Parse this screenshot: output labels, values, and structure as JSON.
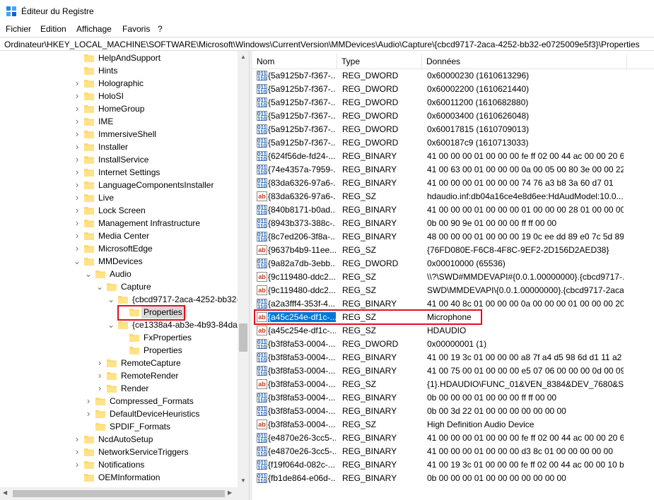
{
  "window": {
    "title": "Éditeur du Registre",
    "icon": "registry-editor-icon"
  },
  "menu": [
    "Fichier",
    "Edition",
    "Affichage",
    "Favoris",
    "?"
  ],
  "address": "Ordinateur\\HKEY_LOCAL_MACHINE\\SOFTWARE\\Microsoft\\Windows\\CurrentVersion\\MMDevices\\Audio\\Capture\\{cbcd9717-2aca-4252-bb32-e0725009e5f3}\\Properties",
  "tree": {
    "selected_label": "Properties",
    "items": [
      {
        "label": "HelpAndSupport",
        "depth": 0,
        "expander": ""
      },
      {
        "label": "Hints",
        "depth": 0,
        "expander": ""
      },
      {
        "label": "Holographic",
        "depth": 0,
        "expander": "collapsed"
      },
      {
        "label": "HoloSI",
        "depth": 0,
        "expander": "collapsed"
      },
      {
        "label": "HomeGroup",
        "depth": 0,
        "expander": "collapsed"
      },
      {
        "label": "IME",
        "depth": 0,
        "expander": "collapsed"
      },
      {
        "label": "ImmersiveShell",
        "depth": 0,
        "expander": "collapsed"
      },
      {
        "label": "Installer",
        "depth": 0,
        "expander": "collapsed"
      },
      {
        "label": "InstallService",
        "depth": 0,
        "expander": "collapsed"
      },
      {
        "label": "Internet Settings",
        "depth": 0,
        "expander": "collapsed"
      },
      {
        "label": "LanguageComponentsInstaller",
        "depth": 0,
        "expander": "collapsed"
      },
      {
        "label": "Live",
        "depth": 0,
        "expander": "collapsed"
      },
      {
        "label": "Lock Screen",
        "depth": 0,
        "expander": "collapsed"
      },
      {
        "label": "Management Infrastructure",
        "depth": 0,
        "expander": "collapsed"
      },
      {
        "label": "Media Center",
        "depth": 0,
        "expander": "collapsed"
      },
      {
        "label": "MicrosoftEdge",
        "depth": 0,
        "expander": "collapsed"
      },
      {
        "label": "MMDevices",
        "depth": 0,
        "expander": "expanded"
      },
      {
        "label": "Audio",
        "depth": 1,
        "expander": "expanded"
      },
      {
        "label": "Capture",
        "depth": 2,
        "expander": "expanded"
      },
      {
        "label": "{cbcd9717-2aca-4252-bb32-",
        "depth": 3,
        "expander": "expanded"
      },
      {
        "label": "Properties",
        "depth": 4,
        "expander": "",
        "selected": true
      },
      {
        "label": "{ce1338a4-ab3e-4b93-84da-",
        "depth": 3,
        "expander": "expanded"
      },
      {
        "label": "FxProperties",
        "depth": 4,
        "expander": ""
      },
      {
        "label": "Properties",
        "depth": 4,
        "expander": ""
      },
      {
        "label": "RemoteCapture",
        "depth": 2,
        "expander": "collapsed"
      },
      {
        "label": "RemoteRender",
        "depth": 2,
        "expander": "collapsed"
      },
      {
        "label": "Render",
        "depth": 2,
        "expander": "collapsed"
      },
      {
        "label": "Compressed_Formats",
        "depth": 1,
        "expander": "collapsed"
      },
      {
        "label": "DefaultDeviceHeuristics",
        "depth": 1,
        "expander": "collapsed"
      },
      {
        "label": "SPDIF_Formats",
        "depth": 1,
        "expander": ""
      },
      {
        "label": "NcdAutoSetup",
        "depth": 0,
        "expander": "collapsed"
      },
      {
        "label": "NetworkServiceTriggers",
        "depth": 0,
        "expander": "collapsed"
      },
      {
        "label": "Notifications",
        "depth": 0,
        "expander": "collapsed"
      },
      {
        "label": "OEMInformation",
        "depth": 0,
        "expander": ""
      }
    ]
  },
  "list": {
    "columns": [
      "Nom",
      "Type",
      "Données"
    ],
    "rows": [
      {
        "name": "{5a9125b7-f367-...",
        "type": "REG_DWORD",
        "data": "0x60000230 (1610613296)",
        "icon": "binary-value-icon"
      },
      {
        "name": "{5a9125b7-f367-...",
        "type": "REG_DWORD",
        "data": "0x60002200 (1610621440)",
        "icon": "binary-value-icon"
      },
      {
        "name": "{5a9125b7-f367-...",
        "type": "REG_DWORD",
        "data": "0x60011200 (1610682880)",
        "icon": "binary-value-icon"
      },
      {
        "name": "{5a9125b7-f367-...",
        "type": "REG_DWORD",
        "data": "0x60003400 (1610626048)",
        "icon": "binary-value-icon"
      },
      {
        "name": "{5a9125b7-f367-...",
        "type": "REG_DWORD",
        "data": "0x60017815 (1610709013)",
        "icon": "binary-value-icon"
      },
      {
        "name": "{5a9125b7-f367-...",
        "type": "REG_DWORD",
        "data": "0x600187c9 (1610713033)",
        "icon": "binary-value-icon"
      },
      {
        "name": "{624f56de-fd24-...",
        "type": "REG_BINARY",
        "data": "41 00 00 00 01 00 00 00 fe ff 02 00 44 ac 00 00 20 62 ...",
        "icon": "binary-value-icon"
      },
      {
        "name": "{74e4357a-7959-...",
        "type": "REG_BINARY",
        "data": "41 00 63 00 01 00 00 00 0a 00 05 00 80 3e 00 00 22 56...",
        "icon": "binary-value-icon"
      },
      {
        "name": "{83da6326-97a6-...",
        "type": "REG_BINARY",
        "data": "41 00 00 00 01 00 00 00 74 76 a3 b8 3a 60 d7 01",
        "icon": "binary-value-icon"
      },
      {
        "name": "{83da6326-97a6-...",
        "type": "REG_SZ",
        "data": "hdaudio.inf:db04a16ce4e8d6ee:HdAudModel:10.0....",
        "icon": "string-value-icon"
      },
      {
        "name": "{840b8171-b0ad...",
        "type": "REG_BINARY",
        "data": "41 00 00 00 01 00 00 00 01 00 00 00 28 01 00 00 00 00...",
        "icon": "binary-value-icon"
      },
      {
        "name": "{8943b373-388c-...",
        "type": "REG_BINARY",
        "data": "0b 00 90 9e 01 00 00 00 ff ff 00 00",
        "icon": "binary-value-icon"
      },
      {
        "name": "{8c7ed206-3f8a-...",
        "type": "REG_BINARY",
        "data": "48 00 00 00 01 00 00 00 19 0c ee dd 89 e0 7c 5d 89 5...",
        "icon": "binary-value-icon"
      },
      {
        "name": "{9637b4b9-11ee...",
        "type": "REG_SZ",
        "data": "{76FD080E-F6C8-4F8C-9EF2-2D156D2AED38}",
        "icon": "string-value-icon"
      },
      {
        "name": "{9a82a7db-3ebb...",
        "type": "REG_DWORD",
        "data": "0x00010000 (65536)",
        "icon": "binary-value-icon"
      },
      {
        "name": "{9c119480-ddc2...",
        "type": "REG_SZ",
        "data": "\\\\?\\SWD#MMDEVAPI#{0.0.1.00000000}.{cbcd9717-...",
        "icon": "string-value-icon"
      },
      {
        "name": "{9c119480-ddc2...",
        "type": "REG_SZ",
        "data": "SWD\\MMDEVAPI\\{0.0.1.00000000}.{cbcd9717-2aca...",
        "icon": "string-value-icon"
      },
      {
        "name": "{a2a3fff4-353f-4...",
        "type": "REG_BINARY",
        "data": "41 00 40 8c 01 00 00 00 0a 00 00 00 01 00 00 00 20 ea...",
        "icon": "binary-value-icon"
      },
      {
        "name": "{a45c254e-df1c-...",
        "type": "REG_SZ",
        "data": "Microphone",
        "icon": "string-value-icon",
        "selected": true
      },
      {
        "name": "{a45c254e-df1c-...",
        "type": "REG_SZ",
        "data": "HDAUDIO",
        "icon": "string-value-icon"
      },
      {
        "name": "{b3f8fa53-0004-...",
        "type": "REG_DWORD",
        "data": "0x00000001 (1)",
        "icon": "binary-value-icon"
      },
      {
        "name": "{b3f8fa53-0004-...",
        "type": "REG_BINARY",
        "data": "41 00 19 3c 01 00 00 00 a8 7f a4 d5 98 6d d1 11 a2 1...",
        "icon": "binary-value-icon"
      },
      {
        "name": "{b3f8fa53-0004-...",
        "type": "REG_BINARY",
        "data": "41 00 75 00 01 00 00 00 e5 07 06 00 00 00 0d 00 09 0...",
        "icon": "binary-value-icon"
      },
      {
        "name": "{b3f8fa53-0004-...",
        "type": "REG_SZ",
        "data": "{1}.HDAUDIO\\FUNC_01&VEN_8384&DEV_7680&S...",
        "icon": "string-value-icon"
      },
      {
        "name": "{b3f8fa53-0004-...",
        "type": "REG_BINARY",
        "data": "0b 00 00 00 01 00 00 00 ff ff 00 00",
        "icon": "binary-value-icon"
      },
      {
        "name": "{b3f8fa53-0004-...",
        "type": "REG_BINARY",
        "data": "0b 00 3d 22 01 00 00 00 00 00 00 00",
        "icon": "binary-value-icon"
      },
      {
        "name": "{b3f8fa53-0004-...",
        "type": "REG_SZ",
        "data": "High Definition Audio Device",
        "icon": "string-value-icon"
      },
      {
        "name": "{e4870e26-3cc5-...",
        "type": "REG_BINARY",
        "data": "41 00 00 00 01 00 00 00 fe ff 02 00 44 ac 00 00 20 62 ...",
        "icon": "binary-value-icon"
      },
      {
        "name": "{e4870e26-3cc5-...",
        "type": "REG_BINARY",
        "data": "41 00 00 00 01 00 00 00 d3 8c 01 00 00 00 00 00",
        "icon": "binary-value-icon"
      },
      {
        "name": "{f19f064d-082c-...",
        "type": "REG_BINARY",
        "data": "41 00 19 3c 01 00 00 00 fe ff 02 00 44 ac 00 00 10 b1 ...",
        "icon": "binary-value-icon"
      },
      {
        "name": "{fb1de864-e06d-...",
        "type": "REG_BINARY",
        "data": "0b 00 00 00 01 00 00 00 00 00 00 00",
        "icon": "binary-value-icon"
      }
    ]
  },
  "colors": {
    "selection": "#0078d7",
    "highlight_box": "#e2101c",
    "folder": "#ffd967",
    "tree_selection": "#d9d9d9"
  }
}
